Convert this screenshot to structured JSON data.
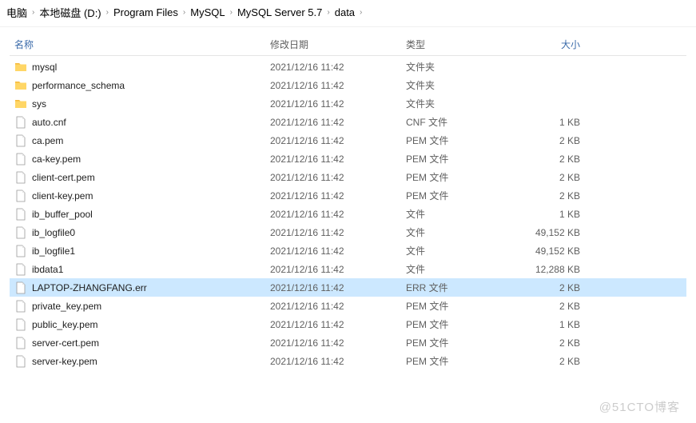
{
  "breadcrumb": [
    "电脑",
    "本地磁盘 (D:)",
    "Program Files",
    "MySQL",
    "MySQL Server 5.7",
    "data"
  ],
  "columns": {
    "name": "名称",
    "date": "修改日期",
    "type": "类型",
    "size": "大小"
  },
  "files": [
    {
      "name": "mysql",
      "date": "2021/12/16 11:42",
      "type": "文件夹",
      "size": "",
      "icon": "folder",
      "selected": false
    },
    {
      "name": "performance_schema",
      "date": "2021/12/16 11:42",
      "type": "文件夹",
      "size": "",
      "icon": "folder",
      "selected": false
    },
    {
      "name": "sys",
      "date": "2021/12/16 11:42",
      "type": "文件夹",
      "size": "",
      "icon": "folder",
      "selected": false
    },
    {
      "name": "auto.cnf",
      "date": "2021/12/16 11:42",
      "type": "CNF 文件",
      "size": "1 KB",
      "icon": "file",
      "selected": false
    },
    {
      "name": "ca.pem",
      "date": "2021/12/16 11:42",
      "type": "PEM 文件",
      "size": "2 KB",
      "icon": "file",
      "selected": false
    },
    {
      "name": "ca-key.pem",
      "date": "2021/12/16 11:42",
      "type": "PEM 文件",
      "size": "2 KB",
      "icon": "file",
      "selected": false
    },
    {
      "name": "client-cert.pem",
      "date": "2021/12/16 11:42",
      "type": "PEM 文件",
      "size": "2 KB",
      "icon": "file",
      "selected": false
    },
    {
      "name": "client-key.pem",
      "date": "2021/12/16 11:42",
      "type": "PEM 文件",
      "size": "2 KB",
      "icon": "file",
      "selected": false
    },
    {
      "name": "ib_buffer_pool",
      "date": "2021/12/16 11:42",
      "type": "文件",
      "size": "1 KB",
      "icon": "file",
      "selected": false
    },
    {
      "name": "ib_logfile0",
      "date": "2021/12/16 11:42",
      "type": "文件",
      "size": "49,152 KB",
      "icon": "file",
      "selected": false
    },
    {
      "name": "ib_logfile1",
      "date": "2021/12/16 11:42",
      "type": "文件",
      "size": "49,152 KB",
      "icon": "file",
      "selected": false
    },
    {
      "name": "ibdata1",
      "date": "2021/12/16 11:42",
      "type": "文件",
      "size": "12,288 KB",
      "icon": "file",
      "selected": false
    },
    {
      "name": "LAPTOP-ZHANGFANG.err",
      "date": "2021/12/16 11:42",
      "type": "ERR 文件",
      "size": "2 KB",
      "icon": "file",
      "selected": true
    },
    {
      "name": "private_key.pem",
      "date": "2021/12/16 11:42",
      "type": "PEM 文件",
      "size": "2 KB",
      "icon": "file",
      "selected": false
    },
    {
      "name": "public_key.pem",
      "date": "2021/12/16 11:42",
      "type": "PEM 文件",
      "size": "1 KB",
      "icon": "file",
      "selected": false
    },
    {
      "name": "server-cert.pem",
      "date": "2021/12/16 11:42",
      "type": "PEM 文件",
      "size": "2 KB",
      "icon": "file",
      "selected": false
    },
    {
      "name": "server-key.pem",
      "date": "2021/12/16 11:42",
      "type": "PEM 文件",
      "size": "2 KB",
      "icon": "file",
      "selected": false
    }
  ],
  "watermark": "@51CTO博客"
}
